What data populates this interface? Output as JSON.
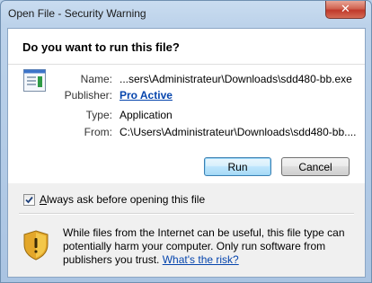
{
  "window": {
    "title": "Open File - Security Warning"
  },
  "dialog": {
    "question": "Do you want to run this file?",
    "fields": {
      "name_label": "Name:",
      "name_value": "...sers\\Administrateur\\Downloads\\sdd480-bb.exe",
      "publisher_label": "Publisher:",
      "publisher_value": "Pro Active",
      "type_label": "Type:",
      "type_value": "Application",
      "from_label": "From:",
      "from_value": "C:\\Users\\Administrateur\\Downloads\\sdd480-bb...."
    },
    "buttons": {
      "run": "Run",
      "cancel": "Cancel"
    },
    "checkbox": {
      "label_first": "A",
      "label_rest": "lways ask before opening this file",
      "checked": true
    },
    "warning": {
      "text": "While files from the Internet can be useful, this file type can potentially harm your computer. Only run software from publishers you trust.",
      "link": "What's the risk?"
    }
  }
}
